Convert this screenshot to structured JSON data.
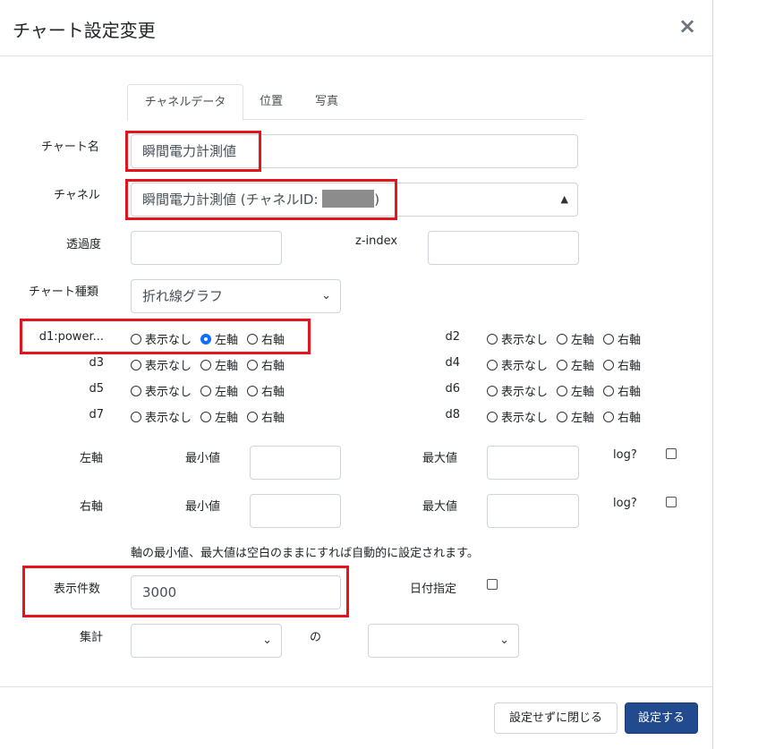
{
  "dialog": {
    "title": "チャート設定変更",
    "close_symbol": "×"
  },
  "tabs": [
    "チャネルデータ",
    "位置",
    "写真"
  ],
  "form": {
    "chart_name_label": "チャート名",
    "chart_name_value": "瞬間電力計測値",
    "channel_label": "チャネル",
    "channel_value_prefix": "瞬間電力計測値 (チャネルID:",
    "channel_value_suffix": ")",
    "opacity_label": "透過度",
    "opacity_value": "",
    "zindex_label": "z-index",
    "zindex_value": "",
    "chart_type_label": "チャート種類",
    "chart_type_value": "折れ線グラフ"
  },
  "radio_options": [
    "表示なし",
    "左軸",
    "右軸"
  ],
  "datasets": [
    {
      "label": "d1:power...",
      "selected": 1
    },
    {
      "label": "d2",
      "selected": -1
    },
    {
      "label": "d3",
      "selected": -1
    },
    {
      "label": "d4",
      "selected": -1
    },
    {
      "label": "d5",
      "selected": -1
    },
    {
      "label": "d6",
      "selected": -1
    },
    {
      "label": "d7",
      "selected": -1
    },
    {
      "label": "d8",
      "selected": -1
    }
  ],
  "axes": {
    "left_label": "左軸",
    "right_label": "右軸",
    "min_label": "最小値",
    "max_label": "最大値",
    "log_label": "log?",
    "note": "軸の最小値、最大値は空白のままにすれば自動的に設定されます。"
  },
  "display": {
    "count_label": "表示件数",
    "count_value": "3000",
    "date_label": "日付指定",
    "aggregate_label": "集計",
    "of_label": "の"
  },
  "footer": {
    "close_label": "設定せずに閉じる",
    "submit_label": "設定する"
  },
  "colors": {
    "highlight": "#e3151b",
    "primary": "#214a8f",
    "radio_on": "#0d6efd"
  }
}
